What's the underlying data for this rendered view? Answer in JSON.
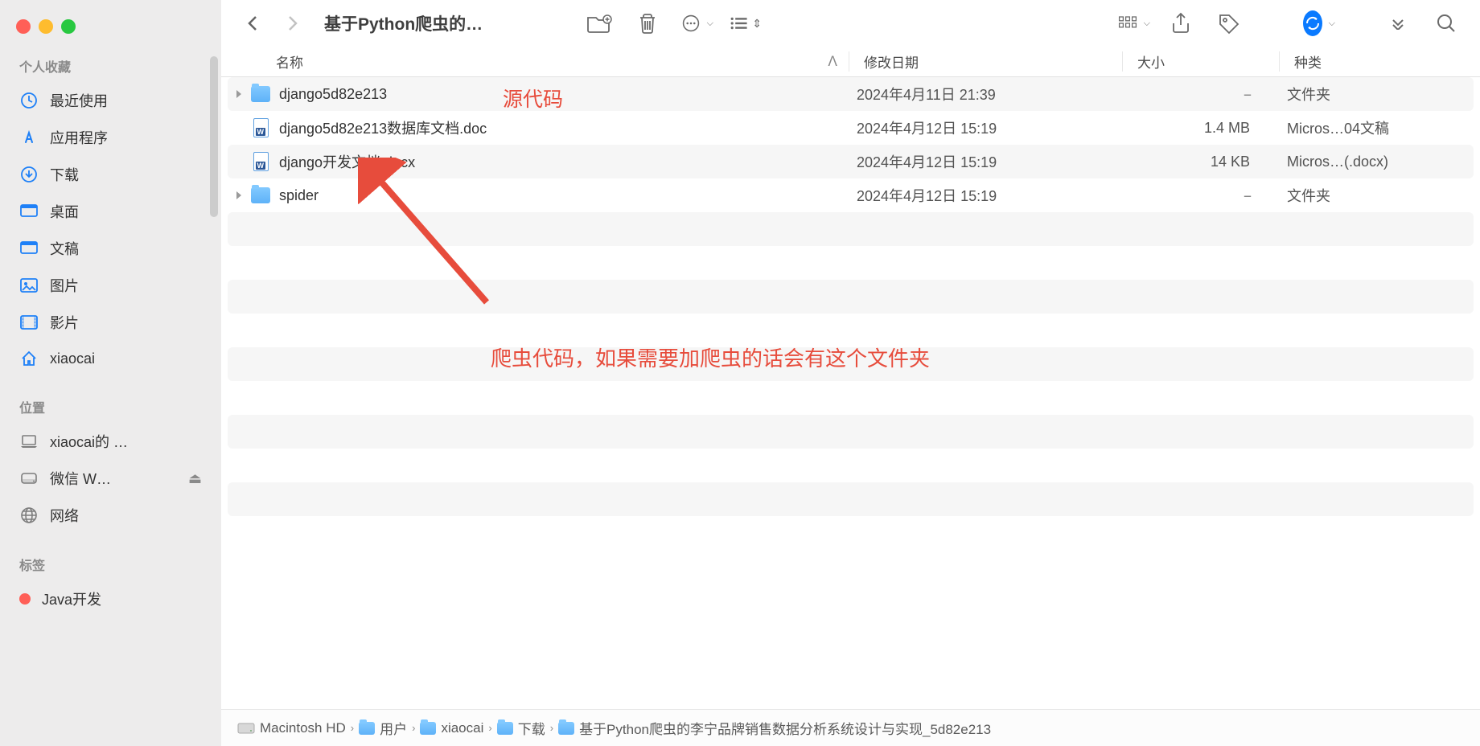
{
  "sidebar": {
    "section_favorites": "个人收藏",
    "section_locations": "位置",
    "section_tags": "标签",
    "favorites": [
      {
        "icon": "clock",
        "label": "最近使用"
      },
      {
        "icon": "app",
        "label": "应用程序"
      },
      {
        "icon": "download",
        "label": "下载"
      },
      {
        "icon": "desktop",
        "label": "桌面"
      },
      {
        "icon": "doc",
        "label": "文稿"
      },
      {
        "icon": "pic",
        "label": "图片"
      },
      {
        "icon": "movie",
        "label": "影片"
      },
      {
        "icon": "home",
        "label": "xiaocai"
      }
    ],
    "locations": [
      {
        "icon": "laptop",
        "label": "xiaocai的 …",
        "gray": true
      },
      {
        "icon": "disk",
        "label": "微信 W…",
        "gray": true,
        "eject": true
      },
      {
        "icon": "globe",
        "label": "网络",
        "gray": true
      }
    ],
    "tags": [
      {
        "color": "red",
        "label": "Java开发"
      }
    ]
  },
  "toolbar": {
    "title": "基于Python爬虫的…"
  },
  "columns": {
    "name": "名称",
    "date": "修改日期",
    "size": "大小",
    "kind": "种类"
  },
  "files": [
    {
      "disclosure": true,
      "icon": "folder",
      "name": "django5d82e213",
      "date": "2024年4月11日 21:39",
      "size": "--",
      "kind": "文件夹",
      "alt": true
    },
    {
      "disclosure": false,
      "icon": "doc",
      "name": "django5d82e213数据库文档.doc",
      "date": "2024年4月12日 15:19",
      "size": "1.4 MB",
      "kind": "Micros…04文稿",
      "alt": false
    },
    {
      "disclosure": false,
      "icon": "doc",
      "name": "django开发文档.docx",
      "date": "2024年4月12日 15:19",
      "size": "14 KB",
      "kind": "Micros…(.docx)",
      "alt": true
    },
    {
      "disclosure": true,
      "icon": "folder",
      "name": "spider",
      "date": "2024年4月12日 15:19",
      "size": "--",
      "kind": "文件夹",
      "alt": false
    }
  ],
  "annotations": {
    "source_code": "源代码",
    "spider_note": "爬虫代码，如果需要加爬虫的话会有这个文件夹"
  },
  "path": [
    {
      "icon": "hd",
      "label": "Macintosh HD"
    },
    {
      "icon": "folder",
      "label": "用户"
    },
    {
      "icon": "folder",
      "label": "xiaocai"
    },
    {
      "icon": "folder",
      "label": "下载"
    },
    {
      "icon": "folder",
      "label": "基于Python爬虫的李宁品牌销售数据分析系统设计与实现_5d82e213"
    }
  ]
}
